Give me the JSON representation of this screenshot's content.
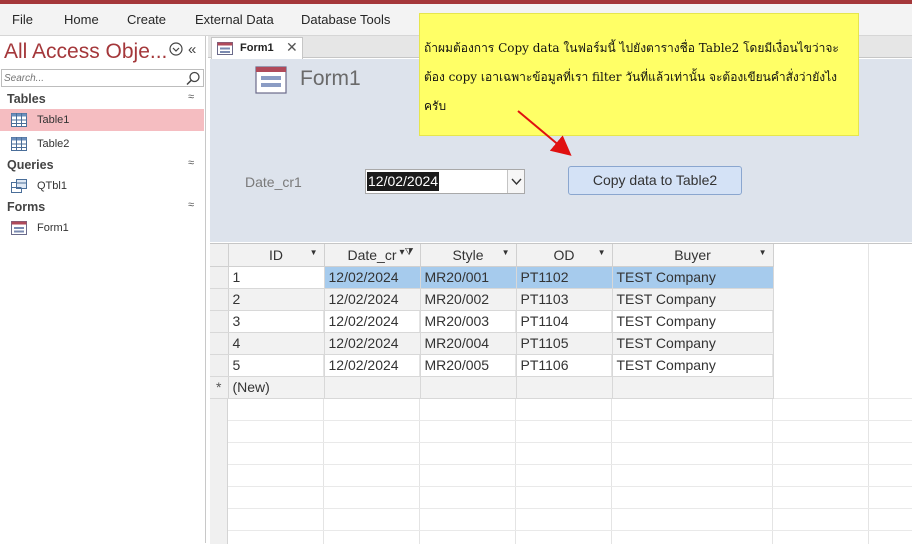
{
  "menu": {
    "file": "File",
    "home": "Home",
    "create": "Create",
    "external_data": "External Data",
    "database_tools": "Database Tools"
  },
  "nav": {
    "title": "All Access Obje...",
    "search_placeholder": "Search...",
    "groups": {
      "tables": "Tables",
      "queries": "Queries",
      "forms": "Forms"
    },
    "items": {
      "table1": "Table1",
      "table2": "Table2",
      "qtbl1": "QTbl1",
      "form1": "Form1"
    }
  },
  "tab": {
    "label": "Form1"
  },
  "form": {
    "title": "Form1",
    "date_label": "Date_cr1",
    "date_value": "12/02/2024",
    "button_label": "Copy data to Table2"
  },
  "note": {
    "text": "ถ้าผมต้องการ Copy data ในฟอร์มนี้ ไปยังตารางชื่อ Table2 โดยมีเงื่อนไขว่าจะต้อง copy เอาเฉพาะข้อมูลที่เรา filter วันที่แล้วเท่านั้น จะต้องเขียนคำสั่งว่ายังไงครับ"
  },
  "datasheet": {
    "columns": [
      "ID",
      "Date_cr",
      "Style",
      "OD",
      "Buyer"
    ],
    "rows": [
      [
        "1",
        "12/02/2024",
        "MR20/001",
        "PT1102",
        "TEST Company"
      ],
      [
        "2",
        "12/02/2024",
        "MR20/002",
        "PT1103",
        "TEST Company"
      ],
      [
        "3",
        "12/02/2024",
        "MR20/003",
        "PT1104",
        "TEST Company"
      ],
      [
        "4",
        "12/02/2024",
        "MR20/004",
        "PT1105",
        "TEST Company"
      ],
      [
        "5",
        "12/02/2024",
        "MR20/005",
        "PT1106",
        "TEST Company"
      ]
    ],
    "new_row_marker": "*",
    "new_row_label": "(New)"
  },
  "colors": {
    "accent": "#a4373a",
    "selected_nav": "#f5bdc1",
    "form_header_bg": "#dde3ec",
    "note_bg": "#ffff66",
    "arrow": "#e01010",
    "current_row": "#a6cbed"
  },
  "icons": [
    "dropdown-icon",
    "collapse-icon",
    "search-icon",
    "table-icon",
    "query-icon",
    "form-icon",
    "close-icon",
    "filter-icon",
    "chevron-down-icon"
  ]
}
